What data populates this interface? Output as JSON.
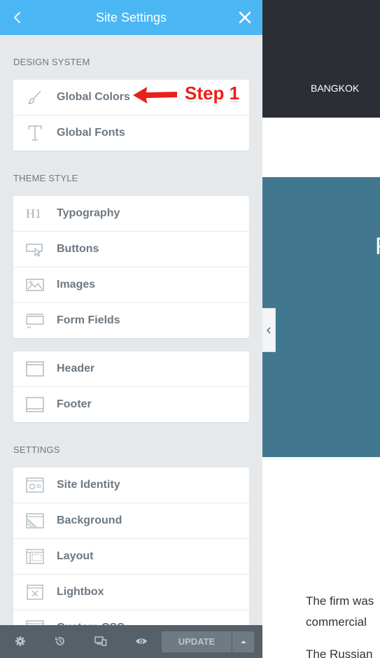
{
  "panel": {
    "title": "Site Settings",
    "sections": [
      {
        "title": "DESIGN SYSTEM",
        "items": [
          {
            "label": "Global Colors",
            "icon": "brush-icon"
          },
          {
            "label": "Global Fonts",
            "icon": "font-t-icon"
          }
        ]
      },
      {
        "title": "THEME STYLE",
        "items": [
          {
            "label": "Typography",
            "icon": "heading-h1-icon"
          },
          {
            "label": "Buttons",
            "icon": "button-cursor-icon"
          },
          {
            "label": "Images",
            "icon": "image-icon"
          },
          {
            "label": "Form Fields",
            "icon": "form-field-icon"
          }
        ]
      },
      {
        "title": "",
        "items": [
          {
            "label": "Header",
            "icon": "header-layout-icon"
          },
          {
            "label": "Footer",
            "icon": "footer-layout-icon"
          }
        ]
      },
      {
        "title": "SETTINGS",
        "items": [
          {
            "label": "Site Identity",
            "icon": "site-identity-icon"
          },
          {
            "label": "Background",
            "icon": "background-icon"
          },
          {
            "label": "Layout",
            "icon": "layout-icon"
          },
          {
            "label": "Lightbox",
            "icon": "lightbox-icon"
          },
          {
            "label": "Custom CSS",
            "icon": "custom-css-icon"
          }
        ]
      }
    ],
    "annotation": "Step 1",
    "bottom_bar": {
      "update_label": "UPDATE"
    }
  },
  "preview": {
    "nav_link": "BANGKOK",
    "hero_letter": "F",
    "paragraph_1": [
      "The firm was",
      "commercial"
    ],
    "paragraph_2": "The Russian"
  },
  "colors": {
    "header_bg": "#4ab7f4",
    "panel_bg": "#e6e9ec",
    "bottom_bar_bg": "#556068",
    "annotation": "#e8211b",
    "hero_bg": "#417890",
    "nav_bg": "#2b2e34"
  }
}
